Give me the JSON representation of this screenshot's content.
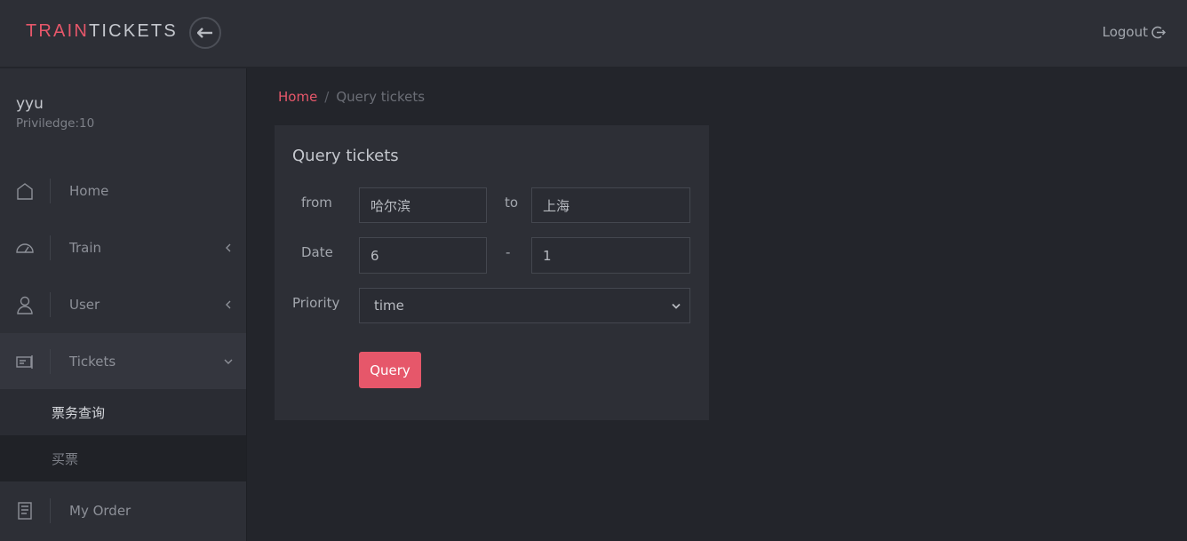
{
  "header": {
    "brand_accent": "TRAIN",
    "brand_rest": "TICKETS",
    "back_icon": "arrow-left-icon",
    "logout_label": "Logout",
    "logout_icon": "logout-icon"
  },
  "user": {
    "name": "yyu",
    "privilege": "Priviledge:10"
  },
  "sidebar": {
    "items": [
      {
        "label": "Home",
        "icon": "home-icon"
      },
      {
        "label": "Train",
        "icon": "speedometer-icon"
      },
      {
        "label": "User",
        "icon": "user-icon"
      },
      {
        "label": "Tickets",
        "icon": "ticket-icon"
      },
      {
        "label": "My Order",
        "icon": "order-icon"
      }
    ],
    "sub_items": [
      {
        "label": "票务查询"
      },
      {
        "label": "买票"
      }
    ]
  },
  "breadcrumb": {
    "home": "Home",
    "separator": "/",
    "current": "Query tickets"
  },
  "form": {
    "title": "Query tickets",
    "from_label": "from",
    "from_value": "哈尔滨",
    "to_label": "to",
    "to_value": "上海",
    "date_label": "Date",
    "month_value": "6",
    "date_separator": "-",
    "day_value": "1",
    "priority_label": "Priority",
    "priority_value": "time",
    "query_label": "Query"
  },
  "colors": {
    "accent": "#e6576a",
    "background": "#23252b",
    "panel": "#2d2f36"
  }
}
